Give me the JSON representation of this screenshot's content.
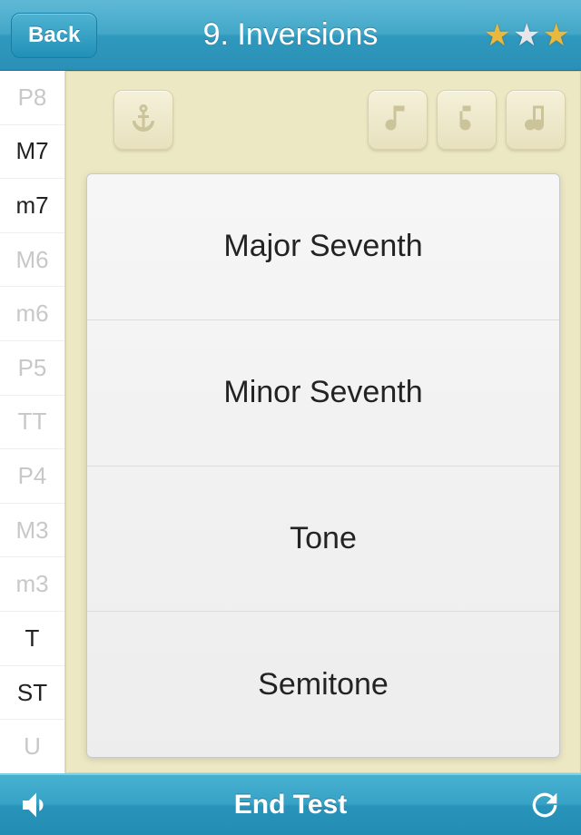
{
  "header": {
    "back_label": "Back",
    "title": "9. Inversions",
    "stars": [
      "gold",
      "silver",
      "gold"
    ]
  },
  "sidebar": {
    "items": [
      {
        "label": "P8",
        "active": false
      },
      {
        "label": "M7",
        "active": true
      },
      {
        "label": "m7",
        "active": true
      },
      {
        "label": "M6",
        "active": false
      },
      {
        "label": "m6",
        "active": false
      },
      {
        "label": "P5",
        "active": false
      },
      {
        "label": "TT",
        "active": false
      },
      {
        "label": "P4",
        "active": false
      },
      {
        "label": "M3",
        "active": false
      },
      {
        "label": "m3",
        "active": false
      },
      {
        "label": "T",
        "active": true
      },
      {
        "label": "ST",
        "active": true
      },
      {
        "label": "U",
        "active": false
      }
    ]
  },
  "toolbar": {
    "icons": [
      "anchor-icon",
      "play-ascending-icon",
      "play-descending-icon",
      "play-harmonic-icon"
    ]
  },
  "options": [
    "Major Seventh",
    "Minor Seventh",
    "Tone",
    "Semitone"
  ],
  "footer": {
    "label": "End Test"
  }
}
